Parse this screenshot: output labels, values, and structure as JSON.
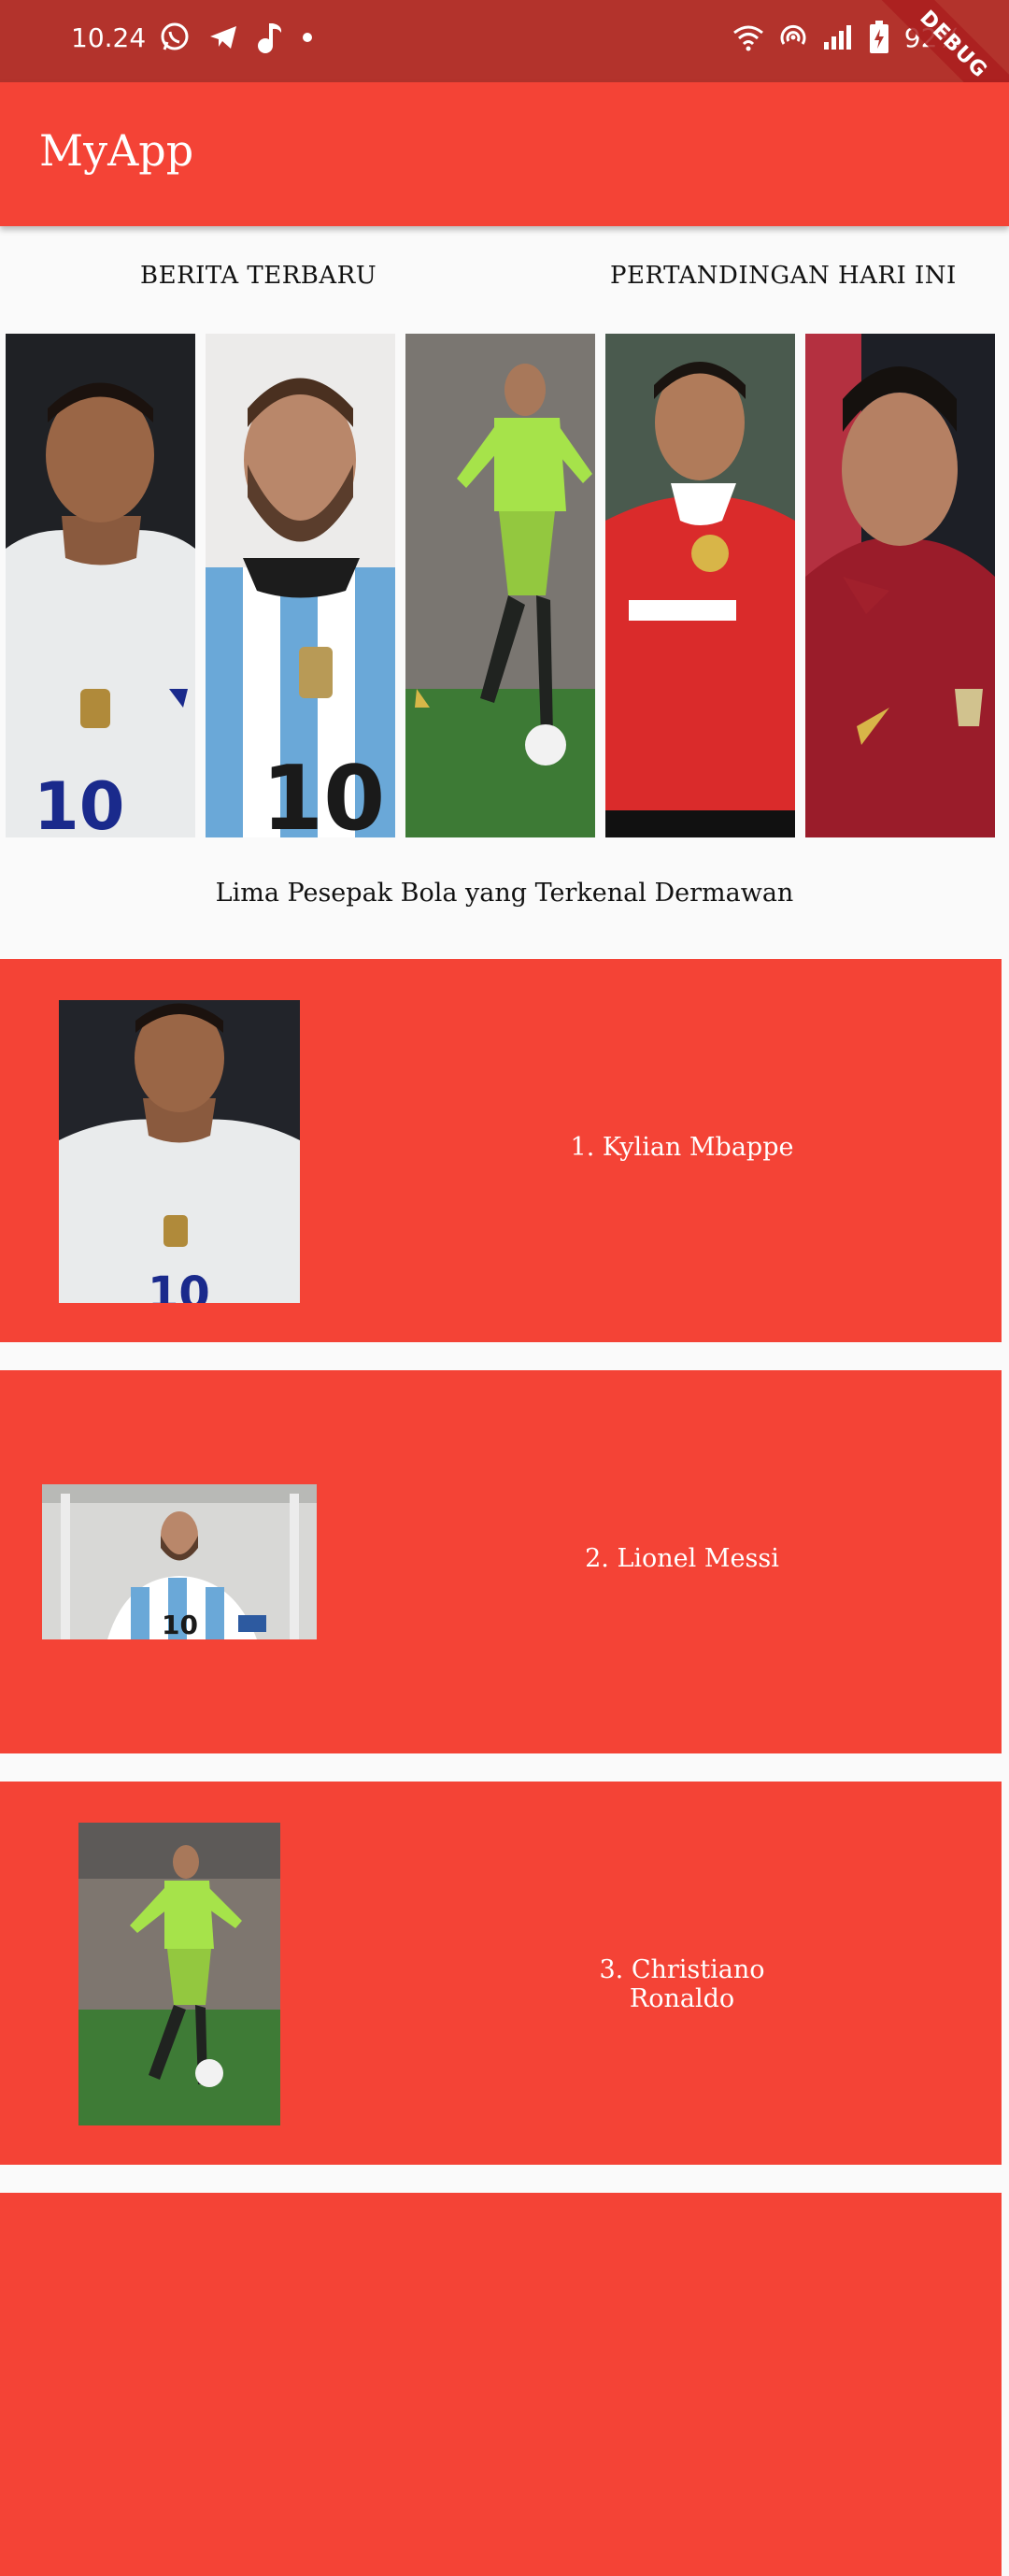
{
  "status_bar": {
    "time": "10.24",
    "battery_text": "92%",
    "left_icons": [
      "whatsapp-icon",
      "telegram-icon",
      "music-note-icon",
      "dot-icon"
    ],
    "right_icons": [
      "wifi-icon",
      "hotspot-icon",
      "signal-icon",
      "battery-charging-icon"
    ],
    "debug_banner": "DEBUG",
    "color": "#b3332c"
  },
  "app_bar": {
    "title": "MyApp",
    "color": "#f44336"
  },
  "sections": {
    "left_heading": "BERITA TERBARU",
    "right_heading": "PERTANDINGAN HARI INI"
  },
  "gallery": [
    {
      "player": "Kylian Mbappe",
      "jersey": "France white",
      "number": "10"
    },
    {
      "player": "Lionel Messi",
      "jersey": "Argentina stripes",
      "number": "10"
    },
    {
      "player": "Christiano Ronaldo",
      "jersey": "Man United green away"
    },
    {
      "player": "Christiano Ronaldo",
      "jersey": "Man United red home"
    },
    {
      "player": "Christiano Ronaldo",
      "jersey": "Portugal red"
    }
  ],
  "subtitle": "Lima Pesepak Bola yang Terkenal Dermawan",
  "list": [
    {
      "label": "1. Kylian Mbappe"
    },
    {
      "label": "2. Lionel Messi"
    },
    {
      "label": "3. Christiano Ronaldo"
    }
  ],
  "card_color": "#f44336"
}
